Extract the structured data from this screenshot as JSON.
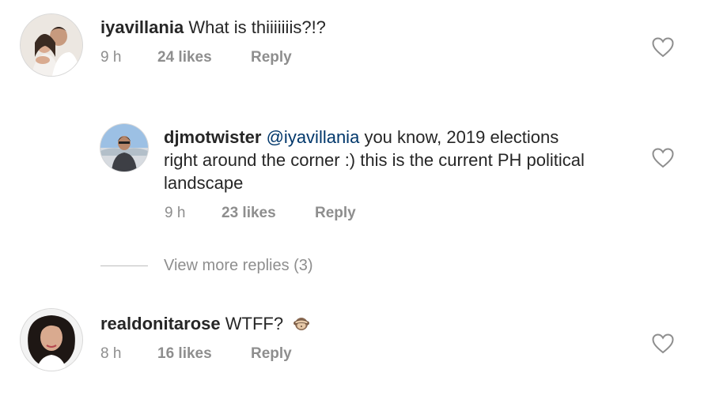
{
  "comments": [
    {
      "username": "iyavillania",
      "text": "What is thiiiiiiis?!?",
      "time": "9 h",
      "likes": "24 likes",
      "reply_label": "Reply",
      "avatar_icon": "couple-photo-avatar"
    },
    {
      "username": "realdonitarose",
      "text": "WTFF?",
      "emoji": "see-no-evil-monkey-emoji",
      "time": "8 h",
      "likes": "16 likes",
      "reply_label": "Reply",
      "avatar_icon": "woman-portrait-avatar"
    }
  ],
  "reply": {
    "username": "djmotwister",
    "mention": "@iyavillania",
    "line1_rest": "you know, 2019 elections",
    "line2": "right around the corner :) this is the current PH political",
    "line3": "landscape",
    "time": "9 h",
    "likes": "23 likes",
    "reply_label": "Reply",
    "avatar_icon": "man-portrait-avatar"
  },
  "view_more": {
    "label": "View more replies (3)"
  },
  "icons": {
    "like": "heart-outline-icon"
  },
  "colors": {
    "text": "#262626",
    "meta": "#8e8e8e",
    "mention": "#00376b"
  }
}
